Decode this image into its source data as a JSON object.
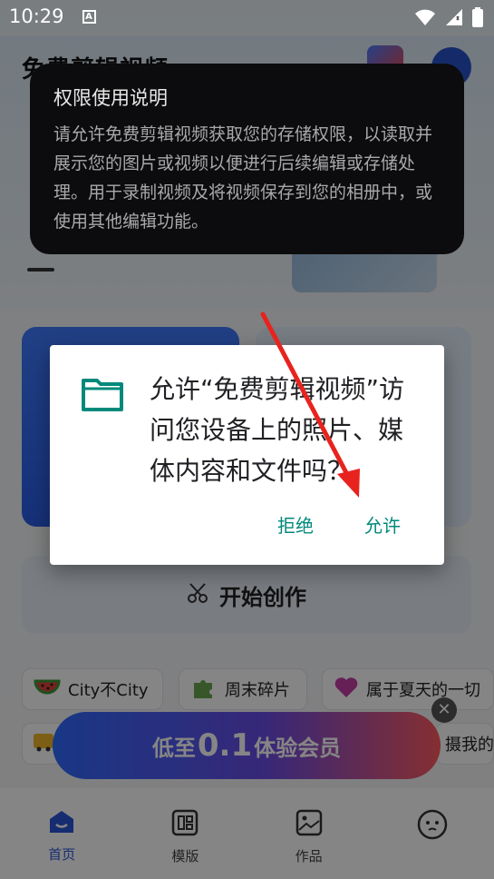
{
  "status_bar": {
    "time": "10:29",
    "notif_icon_letter": "A"
  },
  "app": {
    "title": "免费剪辑视频",
    "create_button_label": "开始创作",
    "chips": [
      {
        "label": "City不City",
        "icon": "watermelon-icon"
      },
      {
        "label": "周末碎片",
        "icon": "puzzle-icon"
      },
      {
        "label": "属于夏天的一切",
        "icon": "heart-icon"
      }
    ],
    "chips_row2_partial": "摄我的",
    "promo": {
      "prefix": "低至",
      "number": "0.1",
      "suffix": "体验会员",
      "close_glyph": "✕"
    },
    "bottom_nav": [
      {
        "label": "首页",
        "icon": "home-icon",
        "active": true
      },
      {
        "label": "模版",
        "icon": "template-icon",
        "active": false
      },
      {
        "label": "作品",
        "icon": "gallery-icon",
        "active": false
      },
      {
        "label": "",
        "icon": "profile-face-icon",
        "active": false
      }
    ]
  },
  "permission_explanation": {
    "title": "权限使用说明",
    "body": "请允许免费剪辑视频获取您的存储权限，以读取并展示您的图片或视频以便进行后续编辑或存储处理。用于录制视频及将视频保存到您的相册中，或使用其他编辑功能。"
  },
  "permission_dialog": {
    "message": "允许“免费剪辑视频”访问您设备上的照片、媒体内容和文件吗？",
    "deny_label": "拒绝",
    "allow_label": "允许",
    "icon": "folder-icon",
    "accent_color": "#00897b"
  },
  "colors": {
    "brand_blue": "#2a55d8",
    "annotation_arrow": "#e8231e",
    "dialog_button": "#00897b"
  }
}
